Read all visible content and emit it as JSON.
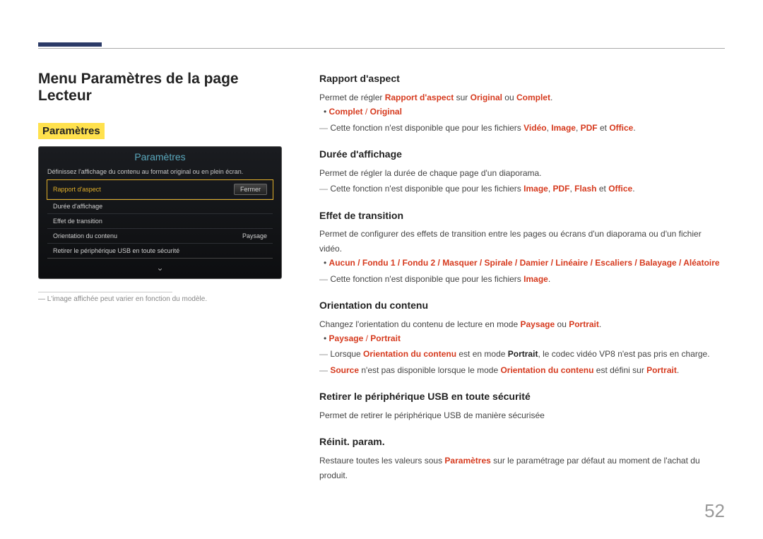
{
  "pageNumber": "52",
  "left": {
    "title": "Menu Paramètres de la page Lecteur",
    "tag": "Paramètres",
    "panel": {
      "title": "Paramètres",
      "desc": "Définissez l'affichage du contenu au format original ou en plein écran.",
      "rows": [
        {
          "label": "Rapport d'aspect",
          "value": ""
        },
        {
          "label": "Durée d'affichage",
          "value": ""
        },
        {
          "label": "Effet de transition",
          "value": ""
        },
        {
          "label": "Orientation du contenu",
          "value": "Paysage"
        },
        {
          "label": "Retirer le périphérique USB en toute sécurité",
          "value": ""
        }
      ],
      "closeLabel": "Fermer"
    },
    "footnote": "L'image affichée peut varier en fonction du modèle."
  },
  "right": {
    "s1": {
      "h": "Rapport d'aspect",
      "p": {
        "a": "Permet de régler ",
        "b": "Rapport d'aspect",
        "c": " sur ",
        "d": "Original",
        "e": " ou ",
        "f": "Complet",
        "g": "."
      },
      "opts": {
        "a": "Complet",
        "sep": " / ",
        "b": "Original"
      },
      "note": {
        "a": "Cette fonction n'est disponible que pour les fichiers ",
        "b": "Vidéo",
        "c": ", ",
        "d": "Image",
        "e": ", ",
        "f": "PDF",
        "g": " et ",
        "h": "Office",
        "i": "."
      }
    },
    "s2": {
      "h": "Durée d'affichage",
      "p": "Permet de régler la durée de chaque page d'un diaporama.",
      "note": {
        "a": "Cette fonction n'est disponible que pour les fichiers ",
        "b": "Image",
        "c": ", ",
        "d": "PDF",
        "e": ", ",
        "f": "Flash",
        "g": " et ",
        "h": "Office",
        "i": "."
      }
    },
    "s3": {
      "h": "Effet de transition",
      "p": "Permet de configurer des effets de transition entre les pages ou écrans d'un diaporama ou d'un fichier vidéo.",
      "opts": "Aucun / Fondu 1 / Fondu 2 / Masquer / Spirale / Damier / Linéaire / Escaliers / Balayage / Aléatoire",
      "note": {
        "a": "Cette fonction n'est disponible que pour les fichiers ",
        "b": "Image",
        "c": "."
      }
    },
    "s4": {
      "h": "Orientation du contenu",
      "p": {
        "a": "Changez l'orientation du contenu de lecture en mode ",
        "b": "Paysage",
        "c": " ou ",
        "d": "Portrait",
        "e": "."
      },
      "opts": {
        "a": "Paysage",
        "sep": " / ",
        "b": "Portrait"
      },
      "note1": {
        "a": "Lorsque ",
        "b": "Orientation du contenu",
        "c": " est en mode ",
        "d": "Portrait",
        "e": ", le codec vidéo VP8 n'est pas pris en charge."
      },
      "note2": {
        "a": "Source",
        "b": " n'est pas disponible lorsque le mode ",
        "c": "Orientation du contenu",
        "d": " est défini sur ",
        "e": "Portrait",
        "f": "."
      }
    },
    "s5": {
      "h": "Retirer le périphérique USB en toute sécurité",
      "p": "Permet de retirer le périphérique USB de manière sécurisée"
    },
    "s6": {
      "h": "Réinit. param.",
      "p": {
        "a": "Restaure toutes les valeurs sous ",
        "b": "Paramètres",
        "c": " sur le paramétrage par défaut au moment de l'achat du produit."
      }
    }
  }
}
